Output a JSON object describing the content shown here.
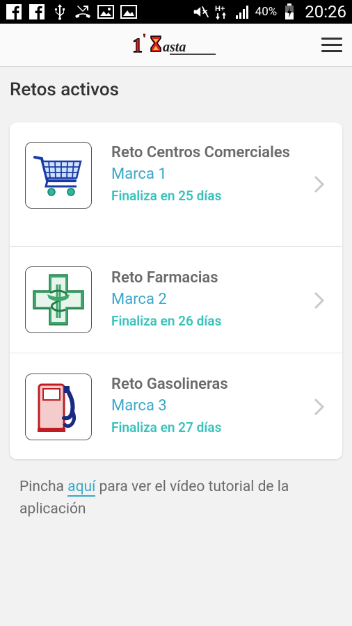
{
  "status_bar": {
    "battery_pct": "40%",
    "time": "20:26",
    "network": "H+"
  },
  "header": {
    "logo_text": "1'Basta"
  },
  "main": {
    "section_title": "Retos activos",
    "challenges": [
      {
        "title": "Reto Centros Comerciales",
        "brand": "Marca 1",
        "ends": "Finaliza en 25 días",
        "icon": "shopping-cart-icon"
      },
      {
        "title": "Reto Farmacias",
        "brand": "Marca 2",
        "ends": "Finaliza en 26 días",
        "icon": "pharmacy-cross-icon"
      },
      {
        "title": "Reto Gasolineras",
        "brand": "Marca 3",
        "ends": "Finaliza en 27 días",
        "icon": "fuel-pump-icon"
      }
    ]
  },
  "footer": {
    "tutorial_prefix": "Pincha ",
    "tutorial_link": "aquí",
    "tutorial_suffix": " para ver el vídeo tutorial de la aplicación"
  },
  "colors": {
    "brand_blue": "#3aa8c9",
    "brand_teal": "#39c2ba",
    "text_gray": "#6a6a6a"
  }
}
